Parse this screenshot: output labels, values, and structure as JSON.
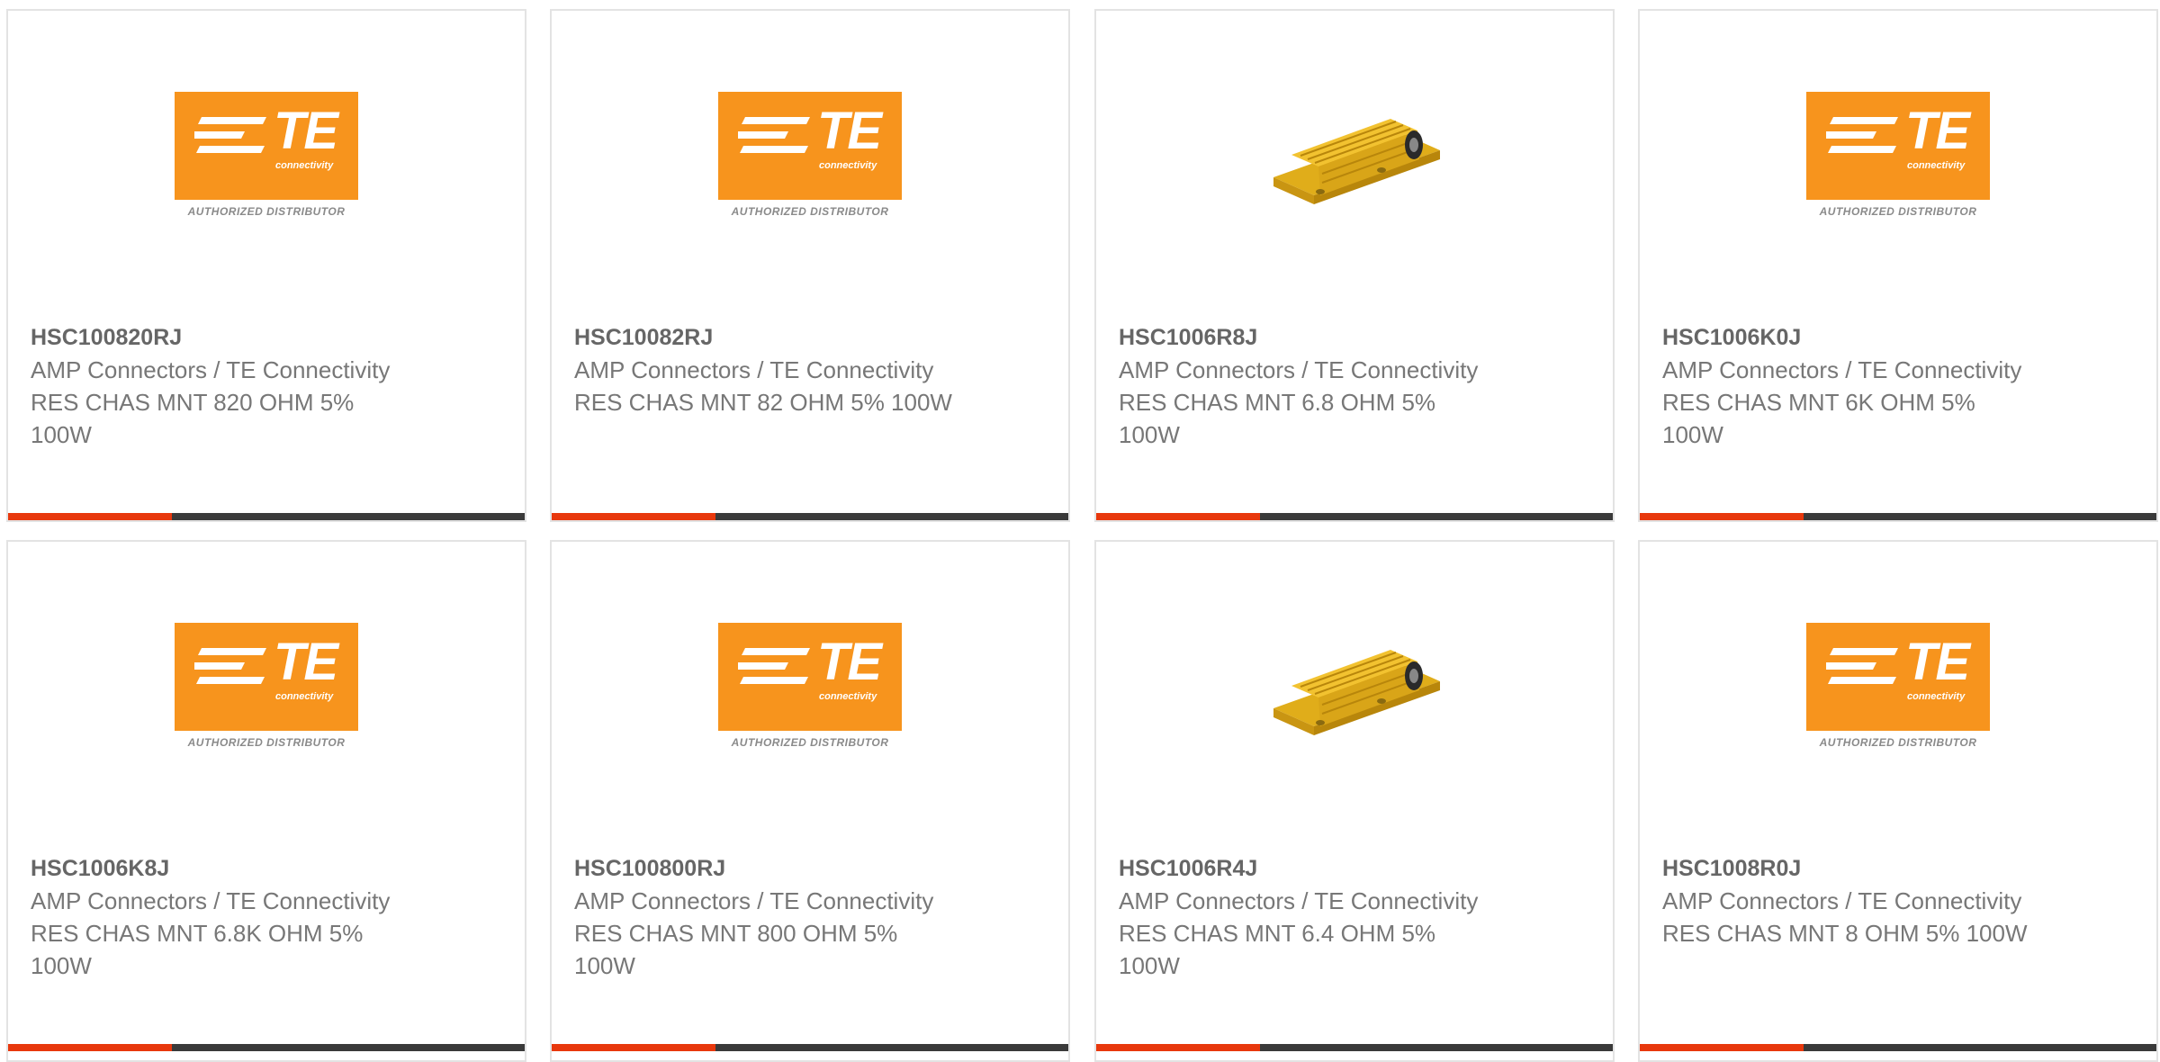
{
  "logo_text": {
    "brand": "TE",
    "tagline": "connectivity",
    "subtitle": "AUTHORIZED DISTRIBUTOR"
  },
  "colors": {
    "accent": "#e8380d",
    "bar": "#3a3a3a",
    "te_orange": "#f7941d",
    "resistor_gold": "#e8b923"
  },
  "products": [
    {
      "part_number": "HSC100820RJ",
      "manufacturer": "AMP Connectors / TE Connectivity",
      "description": "RES CHAS MNT 820 OHM 5% 100W",
      "image": "te-logo"
    },
    {
      "part_number": "HSC10082RJ",
      "manufacturer": "AMP Connectors / TE Connectivity",
      "description": "RES CHAS MNT 82 OHM 5% 100W",
      "image": "te-logo"
    },
    {
      "part_number": "HSC1006R8J",
      "manufacturer": "AMP Connectors / TE Connectivity",
      "description": "RES CHAS MNT 6.8 OHM 5% 100W",
      "image": "resistor-photo"
    },
    {
      "part_number": "HSC1006K0J",
      "manufacturer": "AMP Connectors / TE Connectivity",
      "description": "RES CHAS MNT 6K OHM 5% 100W",
      "image": "te-logo"
    },
    {
      "part_number": "HSC1006K8J",
      "manufacturer": "AMP Connectors / TE Connectivity",
      "description": "RES CHAS MNT 6.8K OHM 5% 100W",
      "image": "te-logo"
    },
    {
      "part_number": "HSC100800RJ",
      "manufacturer": "AMP Connectors / TE Connectivity",
      "description": "RES CHAS MNT 800 OHM 5% 100W",
      "image": "te-logo"
    },
    {
      "part_number": "HSC1006R4J",
      "manufacturer": "AMP Connectors / TE Connectivity",
      "description": "RES CHAS MNT 6.4 OHM 5% 100W",
      "image": "resistor-photo"
    },
    {
      "part_number": "HSC1008R0J",
      "manufacturer": "AMP Connectors / TE Connectivity",
      "description": "RES CHAS MNT 8 OHM 5% 100W",
      "image": "te-logo"
    }
  ]
}
